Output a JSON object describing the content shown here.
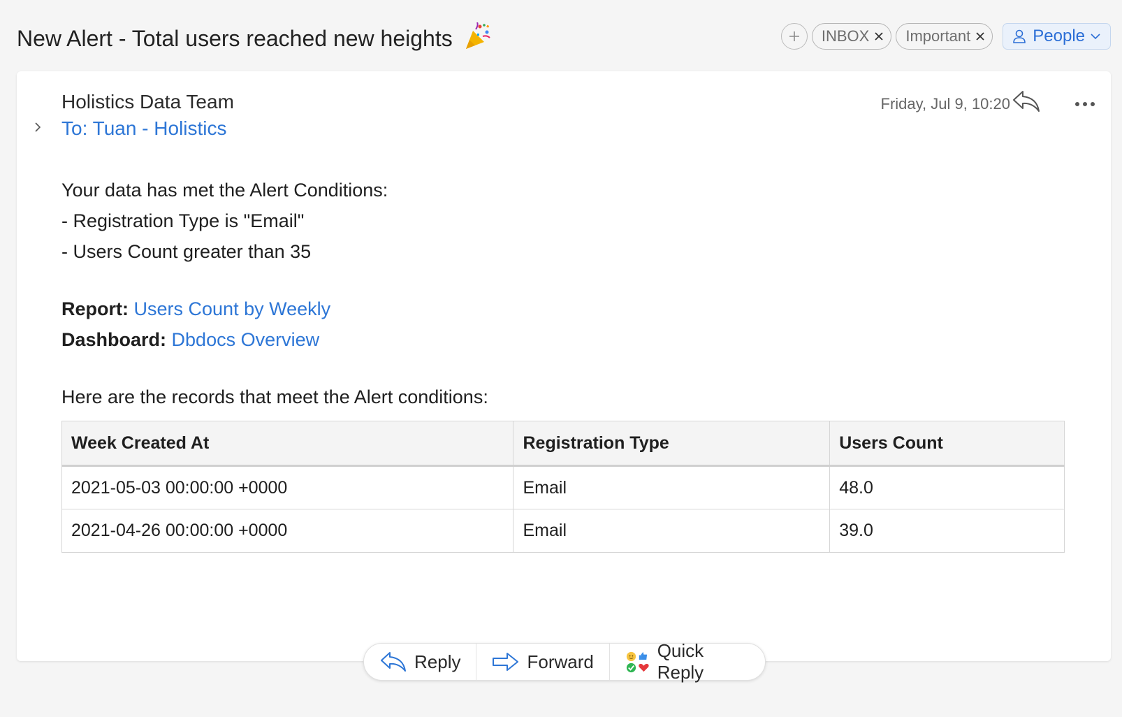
{
  "header": {
    "subject": "New Alert - Total users reached new heights",
    "subject_emoji": "party-popper-icon",
    "tags": [
      {
        "label": "INBOX"
      },
      {
        "label": "Important"
      }
    ],
    "people_label": "People"
  },
  "message": {
    "sender": "Holistics Data Team",
    "to_prefix": "To: ",
    "to_name": "Tuan - Holistics",
    "date": "Friday, Jul 9, 10:20",
    "body": {
      "intro": "Your data has met the Alert Conditions:",
      "conditions": [
        "- Registration Type is \"Email\"",
        "- Users Count greater than 35"
      ],
      "report_label": "Report:",
      "report_link": "Users Count by Weekly",
      "dashboard_label": "Dashboard:",
      "dashboard_link": "Dbdocs Overview",
      "records_intro": "Here are the records that meet the Alert conditions:"
    },
    "table": {
      "headers": [
        "Week Created At",
        "Registration Type",
        "Users Count"
      ],
      "rows": [
        [
          "2021-05-03 00:00:00 +0000",
          "Email",
          "48.0"
        ],
        [
          "2021-04-26 00:00:00 +0000",
          "Email",
          "39.0"
        ]
      ]
    }
  },
  "actions": {
    "reply": "Reply",
    "forward": "Forward",
    "quick_reply": "Quick Reply"
  },
  "colors": {
    "link": "#2d76d6",
    "people_bg": "#eaf1fb",
    "background": "#f5f5f5"
  }
}
